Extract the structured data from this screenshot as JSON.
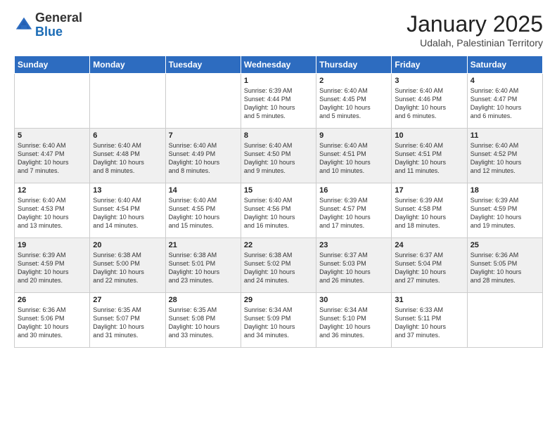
{
  "logo": {
    "general": "General",
    "blue": "Blue"
  },
  "header": {
    "month": "January 2025",
    "location": "Udalah, Palestinian Territory"
  },
  "weekdays": [
    "Sunday",
    "Monday",
    "Tuesday",
    "Wednesday",
    "Thursday",
    "Friday",
    "Saturday"
  ],
  "weeks": [
    [
      {
        "day": "",
        "info": ""
      },
      {
        "day": "",
        "info": ""
      },
      {
        "day": "",
        "info": ""
      },
      {
        "day": "1",
        "info": "Sunrise: 6:39 AM\nSunset: 4:44 PM\nDaylight: 10 hours\nand 5 minutes."
      },
      {
        "day": "2",
        "info": "Sunrise: 6:40 AM\nSunset: 4:45 PM\nDaylight: 10 hours\nand 5 minutes."
      },
      {
        "day": "3",
        "info": "Sunrise: 6:40 AM\nSunset: 4:46 PM\nDaylight: 10 hours\nand 6 minutes."
      },
      {
        "day": "4",
        "info": "Sunrise: 6:40 AM\nSunset: 4:47 PM\nDaylight: 10 hours\nand 6 minutes."
      }
    ],
    [
      {
        "day": "5",
        "info": "Sunrise: 6:40 AM\nSunset: 4:47 PM\nDaylight: 10 hours\nand 7 minutes."
      },
      {
        "day": "6",
        "info": "Sunrise: 6:40 AM\nSunset: 4:48 PM\nDaylight: 10 hours\nand 8 minutes."
      },
      {
        "day": "7",
        "info": "Sunrise: 6:40 AM\nSunset: 4:49 PM\nDaylight: 10 hours\nand 8 minutes."
      },
      {
        "day": "8",
        "info": "Sunrise: 6:40 AM\nSunset: 4:50 PM\nDaylight: 10 hours\nand 9 minutes."
      },
      {
        "day": "9",
        "info": "Sunrise: 6:40 AM\nSunset: 4:51 PM\nDaylight: 10 hours\nand 10 minutes."
      },
      {
        "day": "10",
        "info": "Sunrise: 6:40 AM\nSunset: 4:51 PM\nDaylight: 10 hours\nand 11 minutes."
      },
      {
        "day": "11",
        "info": "Sunrise: 6:40 AM\nSunset: 4:52 PM\nDaylight: 10 hours\nand 12 minutes."
      }
    ],
    [
      {
        "day": "12",
        "info": "Sunrise: 6:40 AM\nSunset: 4:53 PM\nDaylight: 10 hours\nand 13 minutes."
      },
      {
        "day": "13",
        "info": "Sunrise: 6:40 AM\nSunset: 4:54 PM\nDaylight: 10 hours\nand 14 minutes."
      },
      {
        "day": "14",
        "info": "Sunrise: 6:40 AM\nSunset: 4:55 PM\nDaylight: 10 hours\nand 15 minutes."
      },
      {
        "day": "15",
        "info": "Sunrise: 6:40 AM\nSunset: 4:56 PM\nDaylight: 10 hours\nand 16 minutes."
      },
      {
        "day": "16",
        "info": "Sunrise: 6:39 AM\nSunset: 4:57 PM\nDaylight: 10 hours\nand 17 minutes."
      },
      {
        "day": "17",
        "info": "Sunrise: 6:39 AM\nSunset: 4:58 PM\nDaylight: 10 hours\nand 18 minutes."
      },
      {
        "day": "18",
        "info": "Sunrise: 6:39 AM\nSunset: 4:59 PM\nDaylight: 10 hours\nand 19 minutes."
      }
    ],
    [
      {
        "day": "19",
        "info": "Sunrise: 6:39 AM\nSunset: 4:59 PM\nDaylight: 10 hours\nand 20 minutes."
      },
      {
        "day": "20",
        "info": "Sunrise: 6:38 AM\nSunset: 5:00 PM\nDaylight: 10 hours\nand 22 minutes."
      },
      {
        "day": "21",
        "info": "Sunrise: 6:38 AM\nSunset: 5:01 PM\nDaylight: 10 hours\nand 23 minutes."
      },
      {
        "day": "22",
        "info": "Sunrise: 6:38 AM\nSunset: 5:02 PM\nDaylight: 10 hours\nand 24 minutes."
      },
      {
        "day": "23",
        "info": "Sunrise: 6:37 AM\nSunset: 5:03 PM\nDaylight: 10 hours\nand 26 minutes."
      },
      {
        "day": "24",
        "info": "Sunrise: 6:37 AM\nSunset: 5:04 PM\nDaylight: 10 hours\nand 27 minutes."
      },
      {
        "day": "25",
        "info": "Sunrise: 6:36 AM\nSunset: 5:05 PM\nDaylight: 10 hours\nand 28 minutes."
      }
    ],
    [
      {
        "day": "26",
        "info": "Sunrise: 6:36 AM\nSunset: 5:06 PM\nDaylight: 10 hours\nand 30 minutes."
      },
      {
        "day": "27",
        "info": "Sunrise: 6:35 AM\nSunset: 5:07 PM\nDaylight: 10 hours\nand 31 minutes."
      },
      {
        "day": "28",
        "info": "Sunrise: 6:35 AM\nSunset: 5:08 PM\nDaylight: 10 hours\nand 33 minutes."
      },
      {
        "day": "29",
        "info": "Sunrise: 6:34 AM\nSunset: 5:09 PM\nDaylight: 10 hours\nand 34 minutes."
      },
      {
        "day": "30",
        "info": "Sunrise: 6:34 AM\nSunset: 5:10 PM\nDaylight: 10 hours\nand 36 minutes."
      },
      {
        "day": "31",
        "info": "Sunrise: 6:33 AM\nSunset: 5:11 PM\nDaylight: 10 hours\nand 37 minutes."
      },
      {
        "day": "",
        "info": ""
      }
    ]
  ]
}
